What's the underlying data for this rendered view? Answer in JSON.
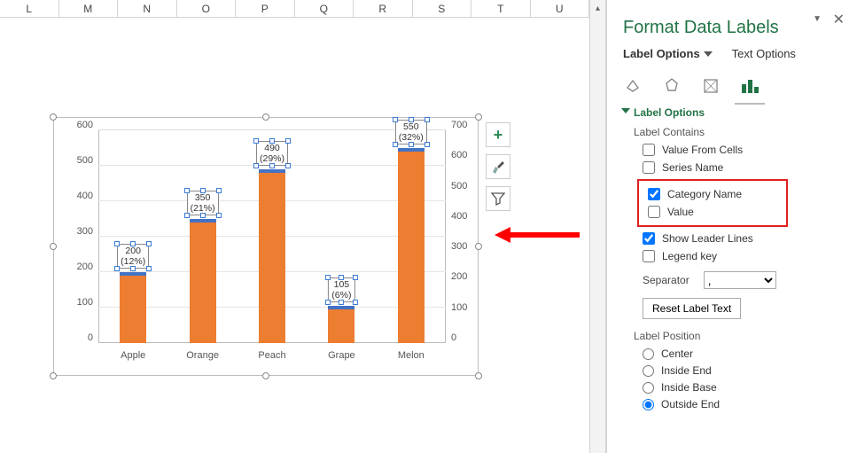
{
  "columns": [
    "L",
    "M",
    "N",
    "O",
    "P",
    "Q",
    "R",
    "S",
    "T",
    "U"
  ],
  "chart_tools": {
    "plus": "+",
    "brush": "brush-icon",
    "filter": "filter-icon"
  },
  "chart_data": {
    "type": "bar",
    "categories": [
      "Apple",
      "Orange",
      "Peach",
      "Grape",
      "Melon"
    ],
    "values": [
      200,
      350,
      490,
      105,
      550
    ],
    "percents": [
      "(12%)",
      "(21%)",
      "(29%)",
      "(6%)",
      "(32%)"
    ],
    "ylim_left": [
      0,
      600
    ],
    "ylim_right": [
      0,
      700
    ],
    "yticks_left": [
      0,
      100,
      200,
      300,
      400,
      500,
      600
    ],
    "yticks_right": [
      0,
      100,
      200,
      300,
      400,
      500,
      600,
      700
    ],
    "bar_color": "#ed7d31",
    "accent_color": "#4472c4"
  },
  "pane": {
    "title": "Format Data Labels",
    "tabs": {
      "label_options": "Label Options",
      "text_options": "Text Options"
    },
    "section_label_options": "Label Options",
    "label_contains": "Label Contains",
    "checks": {
      "value_from_cells": "Value From Cells",
      "series_name": "Series Name",
      "category_name": "Category Name",
      "value": "Value",
      "show_leader": "Show Leader Lines",
      "legend_key": "Legend key"
    },
    "separator_label": "Separator",
    "separator_value": ",",
    "reset": "Reset Label Text",
    "label_position": "Label Position",
    "radios": {
      "center": "Center",
      "inside_end": "Inside End",
      "inside_base": "Inside Base",
      "outside_end": "Outside End"
    }
  }
}
